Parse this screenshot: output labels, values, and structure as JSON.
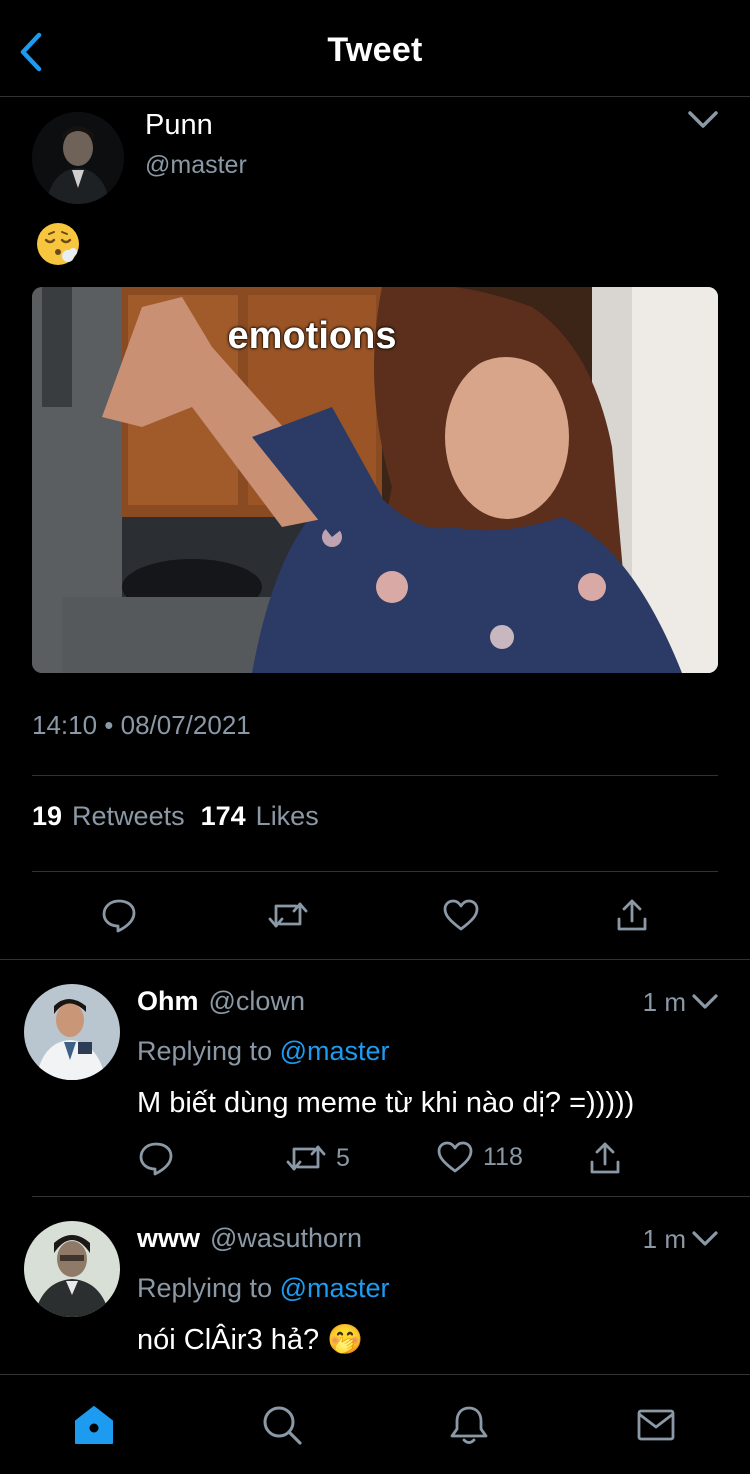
{
  "header": {
    "title": "Tweet",
    "back_icon": "chevron-left-icon"
  },
  "tweet": {
    "author_name": "Punn",
    "author_handle": "@master",
    "emoji": "face-exhaling-emoji",
    "media_caption": "emotions",
    "timestamp": "14:10 • 08/07/2021",
    "retweet_count": "19",
    "retweet_label": "Retweets",
    "like_count": "174",
    "like_label": "Likes"
  },
  "replies": [
    {
      "name": "Ohm",
      "handle": "@clown",
      "time": "1 m",
      "replying_prefix": "Replying to",
      "replying_to": "@master",
      "text": "M biết dùng meme từ khi nào dị? =)))))",
      "retweets": "5",
      "likes": "118"
    },
    {
      "name": "www",
      "handle": "@wasuthorn",
      "time": "1 m",
      "replying_prefix": "Replying to",
      "replying_to": "@master",
      "text": "nói ClÂir3 hả? 🤭"
    }
  ],
  "tabbar": {
    "items": [
      "home-icon",
      "search-icon",
      "notifications-icon",
      "messages-icon"
    ],
    "active": "home-icon"
  },
  "colors": {
    "accent": "#1d9bf0",
    "secondary_text": "#8b98a5",
    "divider": "#2f3336",
    "background": "#000000"
  }
}
